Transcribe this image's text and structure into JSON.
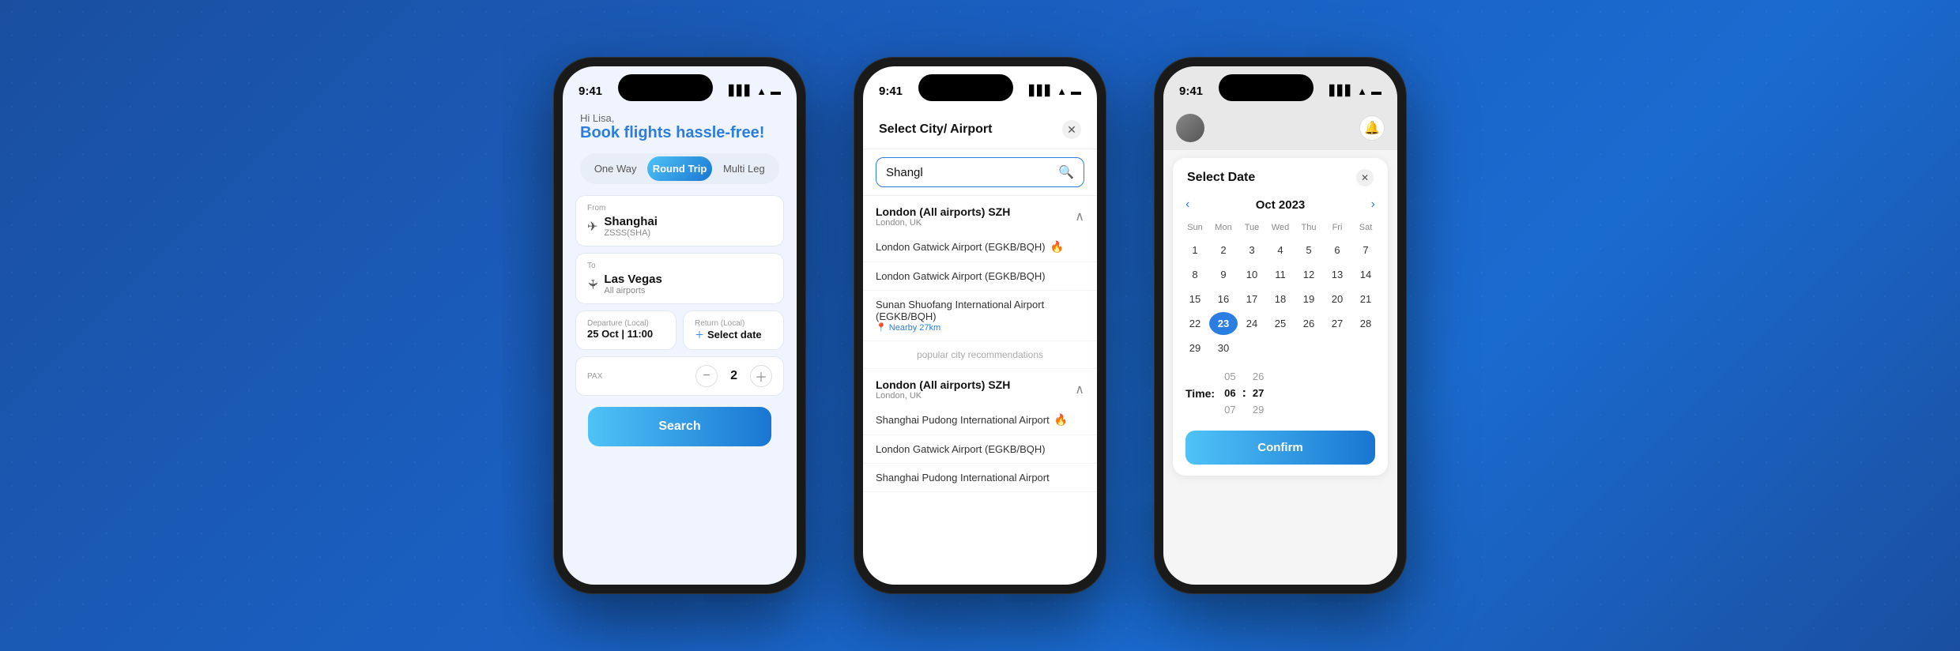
{
  "phone1": {
    "statusTime": "9:41",
    "greeting": "Hi Lisa,",
    "title": "Book flights ",
    "titleHighlight": "hassle-free!",
    "tabs": [
      "One Way",
      "Round Trip",
      "Multi Leg"
    ],
    "activeTab": 1,
    "fromLabel": "From",
    "fromMain": "Shanghai",
    "fromSub": "ZSSS(SHA)",
    "toLabel": "To",
    "toMain": "Las Vegas",
    "toSub": "All airports",
    "departureLabel": "Departure (Local)",
    "departureVal": "25 Oct | 11:00",
    "returnLabel": "Return (Local)",
    "returnVal": "Select date",
    "paxLabel": "PAX",
    "paxCount": "2",
    "searchLabel": "Search"
  },
  "phone2": {
    "statusTime": "9:41",
    "modalTitle": "Select City/ Airport",
    "searchPlaceholder": "Shangl",
    "group1Name": "London (All airports) SZH",
    "group1Sub": "London, UK",
    "airports": [
      {
        "name": "London Gatwick Airport (EGKB/BQH)",
        "hot": true
      },
      {
        "name": "London Gatwick Airport (EGKB/BQH)",
        "hot": false
      },
      {
        "name": "Sunan Shuofang International Airport (EGKB/BQH)",
        "nearby": "Nearby 27km"
      }
    ],
    "popularLabel": "popular city recommendations",
    "group2Name": "London (All airports) SZH",
    "group2Sub": "London, UK",
    "airports2": [
      {
        "name": "Shanghai Pudong International Airport",
        "hot": true
      },
      {
        "name": "London Gatwick Airport (EGKB/BQH)",
        "hot": false
      },
      {
        "name": "Shanghai Pudong International Airport",
        "hot": false
      }
    ]
  },
  "phone3": {
    "statusTime": "9:41",
    "modalTitle": "Select Date",
    "month": "Oct 2023",
    "daysOfWeek": [
      "Sun",
      "Mon",
      "Tue",
      "Wed",
      "Thu",
      "Fri",
      "Sat"
    ],
    "weeks": [
      [
        "",
        "",
        "",
        "",
        "",
        "",
        ""
      ],
      [
        "1",
        "2",
        "3",
        "4",
        "5",
        "6",
        "7"
      ],
      [
        "8",
        "9",
        "10",
        "11",
        "12",
        "13",
        "14"
      ],
      [
        "15",
        "16",
        "17",
        "18",
        "19",
        "20",
        "21"
      ],
      [
        "22",
        "23",
        "24",
        "25",
        "26",
        "27",
        "28"
      ],
      [
        "29",
        "30",
        "",
        "",
        "",
        "",
        ""
      ]
    ],
    "selectedDay": "23",
    "timeLabel": "Time:",
    "hourBefore": "05",
    "hourActive": "06",
    "hourAfter": "07",
    "minuteBefore": "26",
    "minuteActive": "27",
    "minuteAfter": "29",
    "confirmLabel": "Confirm"
  }
}
